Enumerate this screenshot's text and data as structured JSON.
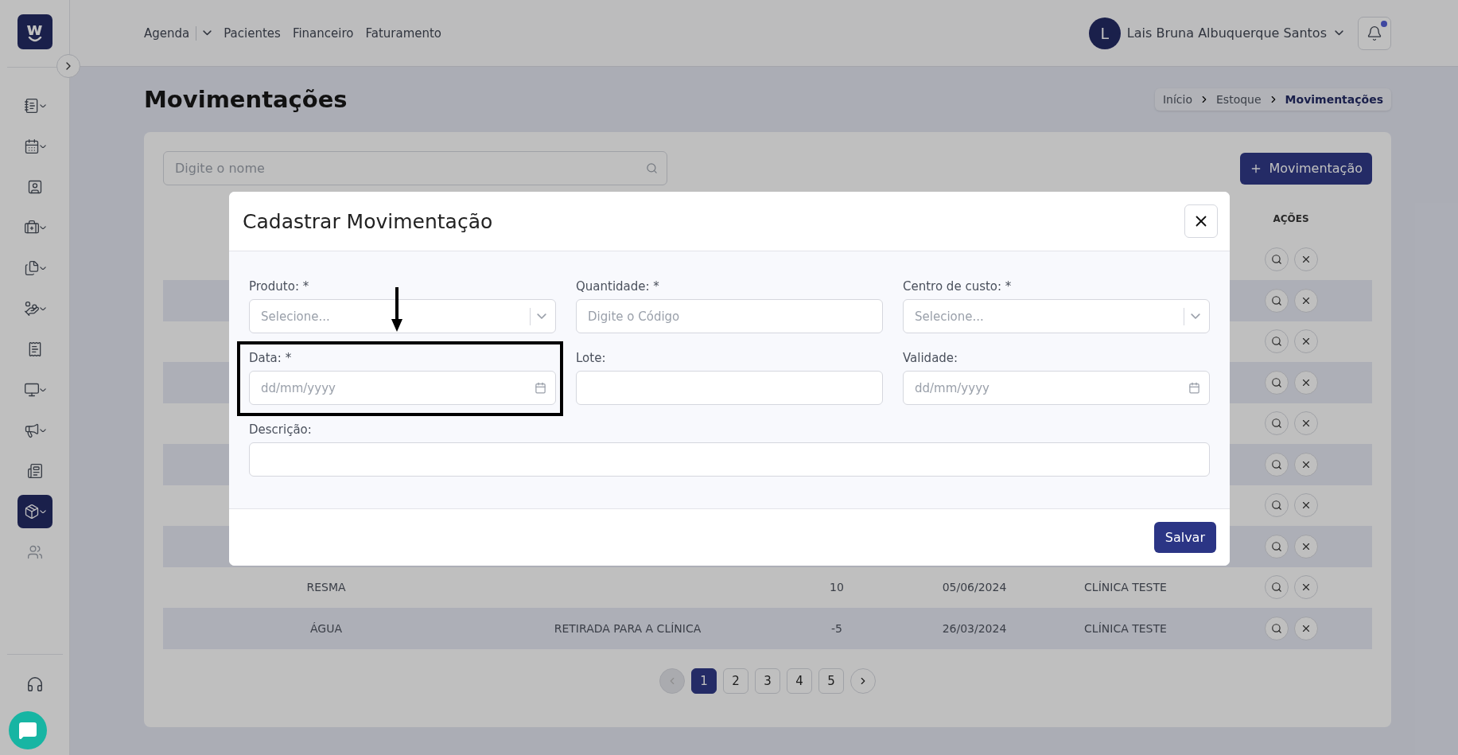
{
  "sidebar": {
    "logo": "w",
    "items": [
      {
        "expandable": true,
        "selected": false,
        "disabled": false
      },
      {
        "expandable": true,
        "selected": false,
        "disabled": false
      },
      {
        "expandable": false,
        "selected": false,
        "disabled": false
      },
      {
        "expandable": true,
        "selected": false,
        "disabled": false
      },
      {
        "expandable": true,
        "selected": false,
        "disabled": false
      },
      {
        "expandable": true,
        "selected": false,
        "disabled": false
      },
      {
        "expandable": false,
        "selected": false,
        "disabled": false
      },
      {
        "expandable": true,
        "selected": false,
        "disabled": false
      },
      {
        "expandable": true,
        "selected": false,
        "disabled": false
      },
      {
        "expandable": false,
        "selected": false,
        "disabled": false
      },
      {
        "expandable": true,
        "selected": true,
        "disabled": false
      },
      {
        "expandable": false,
        "selected": false,
        "disabled": true
      }
    ]
  },
  "header": {
    "nav": [
      {
        "label": "Agenda",
        "has_menu": true
      },
      {
        "label": "Pacientes",
        "has_menu": false
      },
      {
        "label": "Financeiro",
        "has_menu": false
      },
      {
        "label": "Faturamento",
        "has_menu": false
      }
    ],
    "user": {
      "initial": "L",
      "name": "Lais Bruna Albuquerque Santos"
    },
    "notifications": {
      "unread": true
    }
  },
  "page": {
    "title": "Movimentações",
    "breadcrumb": [
      {
        "label": "Início",
        "selected": false
      },
      {
        "label": "Estoque",
        "selected": false
      },
      {
        "label": "Movimentações",
        "selected": true
      }
    ]
  },
  "search": {
    "placeholder": "Digite o nome"
  },
  "add_button": "Movimentação",
  "table": {
    "action_column": "AÇÕES",
    "rows": [
      {
        "striped": false
      },
      {
        "striped": true
      },
      {
        "striped": false
      },
      {
        "striped": true
      },
      {
        "striped": false
      },
      {
        "striped": true
      },
      {
        "striped": false
      },
      {
        "striped": true
      },
      {
        "striped": false,
        "column_1": "RESMA",
        "column_3": "10",
        "column_4": "05/06/2024",
        "column_5": "CLÍNICA TESTE"
      },
      {
        "striped": true,
        "column_1": "ÁGUA",
        "column_2": "RETIRADA PARA A CLÍNICA",
        "column_3": "-5",
        "column_4": "26/03/2024",
        "column_5": "CLÍNICA TESTE"
      }
    ]
  },
  "pagination": {
    "previous_disabled": true,
    "pages": [
      {
        "label": "1",
        "selected": true
      },
      {
        "label": "2",
        "selected": false
      },
      {
        "label": "3",
        "selected": false
      },
      {
        "label": "4",
        "selected": false
      },
      {
        "label": "5",
        "selected": false
      }
    ]
  },
  "modal": {
    "title": "Cadastrar Movimentação",
    "fields": [
      {
        "kind": "select",
        "label": "Produto: *",
        "placeholder": "Selecione...",
        "highlighted": false
      },
      {
        "kind": "text",
        "label": "Quantidade: *",
        "placeholder": "Digite o Código",
        "highlighted": false
      },
      {
        "kind": "select",
        "label": "Centro de custo: *",
        "placeholder": "Selecione...",
        "highlighted": false
      },
      {
        "kind": "date",
        "label": "Data: *",
        "placeholder": "dd/mm/yyyy",
        "highlighted": true
      },
      {
        "kind": "text",
        "label": "Lote:",
        "highlighted": false
      },
      {
        "kind": "date",
        "label": "Validade:",
        "placeholder": "dd/mm/yyyy",
        "highlighted": false
      },
      {
        "kind": "wide",
        "label": "Descrição:",
        "highlighted": false
      }
    ],
    "save_button": "Salvar"
  }
}
